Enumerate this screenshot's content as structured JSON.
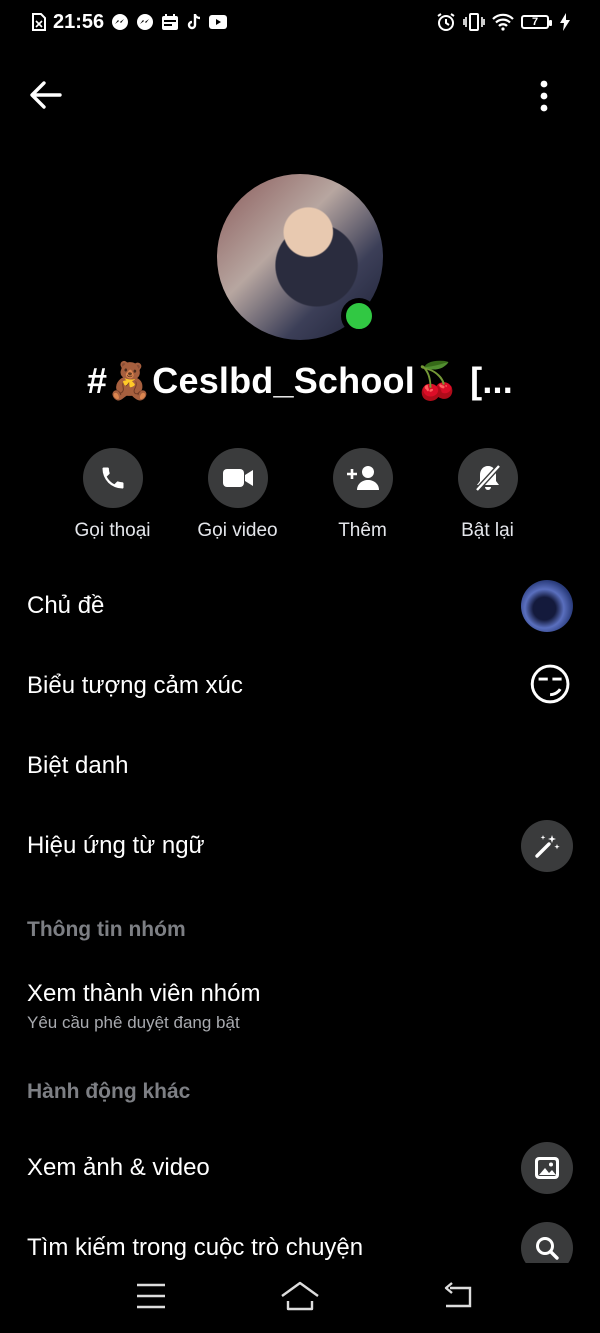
{
  "status_bar": {
    "time": "21:56",
    "battery_level": "7",
    "left_icons": [
      "sim-off-icon",
      "messenger-icon",
      "messenger-icon",
      "calendar-icon",
      "tiktok-icon",
      "youtube-icon"
    ],
    "right_icons": [
      "alarm-icon",
      "vibrate-icon",
      "wifi-icon",
      "battery-icon",
      "charging-icon"
    ]
  },
  "profile": {
    "group_name": "#🧸Ceslbd_School🍒 [...",
    "online_color": "#31c843"
  },
  "actions": [
    {
      "label": "Gọi thoại",
      "icon": "phone-icon"
    },
    {
      "label": "Gọi video",
      "icon": "video-camera-icon"
    },
    {
      "label": "Thêm",
      "icon": "add-person-icon"
    },
    {
      "label": "Bật lại",
      "icon": "bell-muted-icon"
    }
  ],
  "settings": {
    "theme": {
      "title": "Chủ đề"
    },
    "emoji": {
      "title": "Biểu tượng cảm xúc",
      "value": "😏"
    },
    "nicknames": {
      "title": "Biệt danh"
    },
    "word_effects": {
      "title": "Hiệu ứng từ ngữ"
    }
  },
  "group_info": {
    "header": "Thông tin nhóm",
    "members": {
      "title": "Xem thành viên nhóm",
      "subtitle": "Yêu cầu phê duyệt đang bật"
    }
  },
  "other_actions": {
    "header": "Hành động khác",
    "media": {
      "title": "Xem ảnh & video"
    },
    "search": {
      "title": "Tìm kiếm trong cuộc trò chuyện"
    }
  },
  "navbar": [
    "menu-icon",
    "home-icon",
    "back-nav-icon"
  ]
}
